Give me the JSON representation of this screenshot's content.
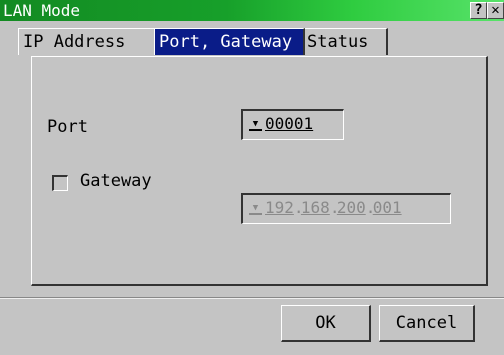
{
  "window": {
    "title": "LAN Mode",
    "help_glyph": "?",
    "close_glyph": "✕"
  },
  "tabs": [
    {
      "label": "IP Address",
      "active": false
    },
    {
      "label": "Port, Gateway",
      "active": true
    },
    {
      "label": "Status",
      "active": false
    }
  ],
  "port": {
    "label": "Port",
    "value": "00001"
  },
  "gateway": {
    "label": "Gateway",
    "checked": false,
    "enabled": false,
    "octets": [
      "192",
      "168",
      "200",
      "001"
    ]
  },
  "buttons": {
    "ok": "OK",
    "cancel": "Cancel"
  },
  "colors": {
    "title_bar": "#17a02a",
    "active_tab": "#0a1c88",
    "background": "#c4c4c4"
  }
}
